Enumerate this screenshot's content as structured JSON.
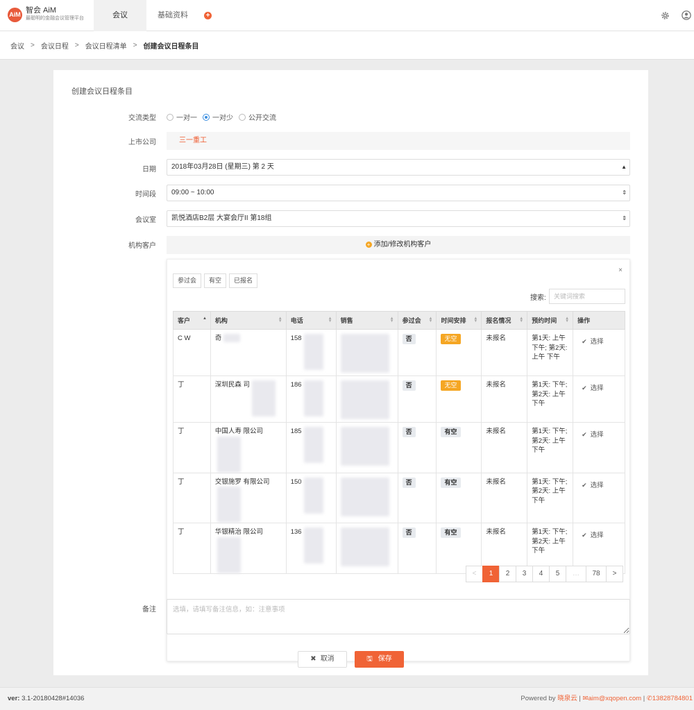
{
  "nav": {
    "logo_title": "智会 AiM",
    "logo_subtitle": "最聪明的金融会议管理平台",
    "logo_mark": "AiM",
    "items": [
      "会议",
      "基础资料"
    ],
    "add_icon": "plus-circle-icon",
    "settings_icon": "gear-icon",
    "user_icon": "user-icon"
  },
  "breadcrumb": [
    "会议",
    "会议日程",
    "会议日程清单",
    "创建会议日程条目"
  ],
  "form": {
    "title": "创建会议日程条目",
    "type_label": "交流类型",
    "types": [
      "一对一",
      "一对少",
      "公开交流"
    ],
    "selected_type": "一对少",
    "company_label": "上市公司",
    "company_value": "三一重工",
    "date_label": "日期",
    "date_value": "2018年03月28日 (星期三) 第 2 天",
    "time_label": "时间段",
    "time_value": "09:00 ~ 10:00",
    "room_label": "会议室",
    "room_value": "凯悦酒店B2层 大宴会厅II 第18组",
    "client_label": "机构客户",
    "add_client": "添加/修改机构客户",
    "notes_label": "备注",
    "notes_placeholder": "选填，请填写备注信息，如：注意事项",
    "cancel": "取消",
    "save": "保存"
  },
  "panel": {
    "close": "×",
    "filters": [
      "参过会",
      "有空",
      "已报名"
    ],
    "search_label": "搜索:",
    "search_placeholder": "关键词搜索",
    "columns": [
      "客户",
      "机构",
      "电话",
      "销售",
      "参过会",
      "时间安排",
      "报名情况",
      "预约时间",
      "操作"
    ],
    "rows": [
      {
        "client": "C W",
        "org": "奇",
        "phone": "158",
        "attended": "否",
        "schedule": "无空",
        "signup": "未报名",
        "booking": "第1天: 上午 下午; 第2天: 上午 下午",
        "action": "选择"
      },
      {
        "client": "丁",
        "org": "深圳民森 司",
        "phone": "186",
        "attended": "否",
        "schedule": "无空",
        "signup": "未报名",
        "booking": "第1天: 下午; 第2天: 上午 下午",
        "action": "选择"
      },
      {
        "client": "丁",
        "org": "中国人寿 限公司",
        "phone": "185",
        "attended": "否",
        "schedule": "有空",
        "signup": "未报名",
        "booking": "第1天: 下午; 第2天: 上午 下午",
        "action": "选择"
      },
      {
        "client": "丁",
        "org": "交银施罗 有限公司",
        "phone": "150",
        "attended": "否",
        "schedule": "有空",
        "signup": "未报名",
        "booking": "第1天: 下午; 第2天: 上午 下午",
        "action": "选择"
      },
      {
        "client": "丁",
        "org": "华银精治 限公司",
        "phone": "136",
        "attended": "否",
        "schedule": "有空",
        "signup": "未报名",
        "booking": "第1天: 下午; 第2天: 上午 下午",
        "action": "选择"
      }
    ],
    "pagination": [
      "<",
      "1",
      "2",
      "3",
      "4",
      "5",
      "…",
      "78",
      ">"
    ],
    "current_page": "1"
  },
  "footer": {
    "version_label": "ver:",
    "version": "3.1-20180428#14036",
    "powered_by": "Powered by",
    "brand": "晓泉云",
    "email": "aim@xqopen.com",
    "phone": "13828784801"
  },
  "colors": {
    "accent": "#f06336",
    "busy": "#f5a623",
    "radio": "#3d8fe0"
  }
}
